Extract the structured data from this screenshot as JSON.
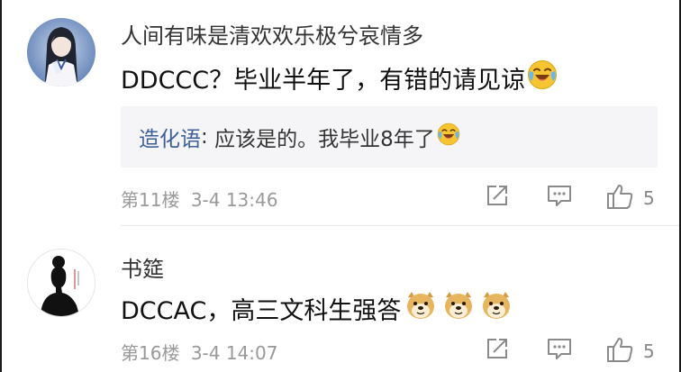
{
  "comments": [
    {
      "username": "人间有味是清欢欢乐极兮哀情多",
      "text": "DDCCC？毕业半年了，有错的请见谅",
      "emojis": [
        "laugh-cry-emoji"
      ],
      "reply": {
        "author": "造化语",
        "separator": ": ",
        "text": "应该是的。我毕业8年了",
        "emoji": "laugh-cry-emoji"
      },
      "floor": "第11楼",
      "time": "3-4 13:46",
      "likes": "5"
    },
    {
      "username": "书筵",
      "text": "DCCAC，高三文科生强答",
      "emojis": [
        "doge-emoji",
        "doge-emoji",
        "doge-emoji"
      ],
      "floor": "第16楼",
      "time": "3-4 14:07",
      "likes": "5"
    }
  ],
  "icons": {
    "share": "share-icon",
    "reply": "comment-icon",
    "like": "thumbs-up-icon"
  },
  "colors": {
    "reply_author": "#3d5f9b",
    "meta_text": "#999999",
    "reply_background": "#f5f5f7"
  }
}
